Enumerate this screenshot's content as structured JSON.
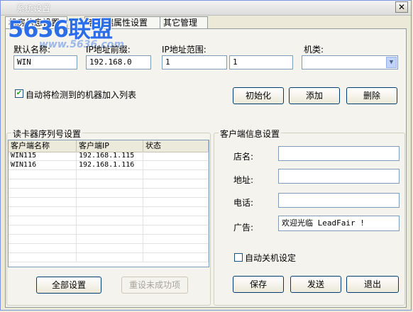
{
  "window": {
    "title": "系统设置",
    "close_symbol": "✕"
  },
  "tabs": [
    {
      "label": "机房信息设置"
    },
    {
      "label": "客户端属性设置"
    },
    {
      "label": "其它管理"
    }
  ],
  "logo": {
    "name": "5636联盟",
    "url": "www.5636.com"
  },
  "top_form": {
    "default_name_label": "默认名称:",
    "default_name_value": "WIN",
    "ip_prefix_label": "IP地址前缀:",
    "ip_prefix_value": "192.168.0",
    "ip_range_label": "IP地址范围:",
    "ip_range_from": "1",
    "ip_range_to": "1",
    "machine_type_label": "机类:",
    "machine_type_value": "",
    "auto_add_label": "自动将检测到的机器加入列表",
    "auto_add_checked": true,
    "init_button": "初始化",
    "add_button": "添加",
    "delete_button": "删除"
  },
  "card_group": {
    "title": "读卡器序列号设置",
    "columns": [
      "客户端名称",
      "客户端IP",
      "状态"
    ],
    "rows": [
      [
        "WIN115",
        "192.168.1.115",
        ""
      ],
      [
        "WIN116",
        "192.168.1.116",
        ""
      ]
    ],
    "set_all_button": "全部设置",
    "reset_failed_button": "重设未成功项"
  },
  "client_info": {
    "title": "客户端信息设置",
    "shop_label": "店名:",
    "shop_value": "",
    "address_label": "地址:",
    "address_value": "",
    "phone_label": "电话:",
    "phone_value": "",
    "ad_label": "广告:",
    "ad_value": "欢迎光临 LeadFair !",
    "auto_shutdown_label": "自动关机设定",
    "auto_shutdown_checked": false,
    "save_button": "保存",
    "send_button": "发送",
    "exit_button": "退出"
  },
  "colors": {
    "window_bg": "#ece9d8",
    "field_border": "#7f9db9",
    "button_border": "#003c74",
    "logo_blue": "#2b6ee8"
  },
  "icons": {
    "close": "close-icon",
    "dropdown": "chevron-down-icon",
    "checkmark": "checkmark-icon"
  }
}
